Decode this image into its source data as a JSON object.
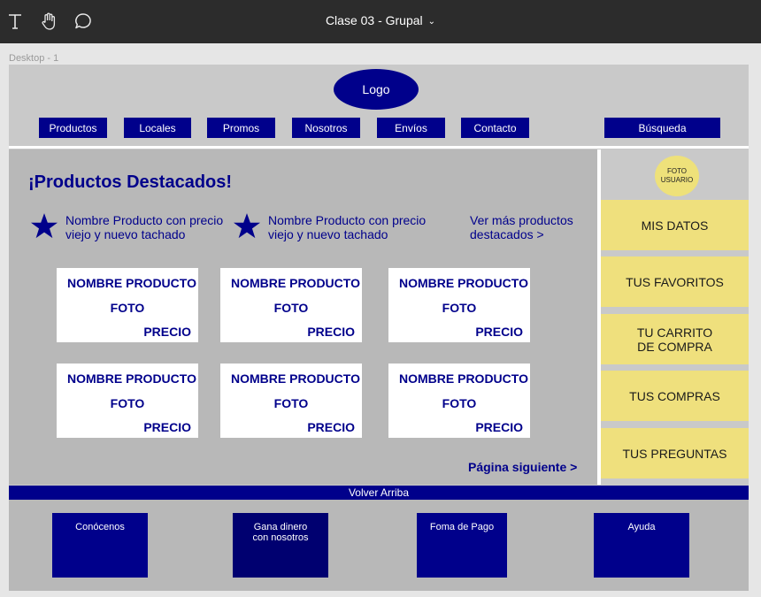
{
  "app": {
    "title": "Clase 03 - Grupal",
    "frame_label": "Desktop - 1"
  },
  "tools": [
    "text-tool-icon",
    "hand-tool-icon",
    "comment-tool-icon"
  ],
  "header": {
    "logo": "Logo",
    "nav": [
      "Productos",
      "Locales",
      "Promos",
      "Nosotros",
      "Envíos",
      "Contacto"
    ],
    "search": "Búsqueda"
  },
  "main": {
    "title": "¡Productos Destacados!",
    "featured": [
      {
        "line1": "Nombre Producto con precio",
        "line2": "viejo y nuevo tachado"
      },
      {
        "line1": "Nombre Producto con precio",
        "line2": "viejo y nuevo tachado"
      }
    ],
    "see_more": {
      "line1": "Ver más productos",
      "line2": "destacados >"
    },
    "cards": [
      {
        "name": "NOMBRE PRODUCTO",
        "photo": "FOTO",
        "price": "PRECIO"
      },
      {
        "name": "NOMBRE PRODUCTO",
        "photo": "FOTO",
        "price": "PRECIO"
      },
      {
        "name": "NOMBRE PRODUCTO",
        "photo": "FOTO",
        "price": "PRECIO"
      },
      {
        "name": "NOMBRE PRODUCTO",
        "photo": "FOTO",
        "price": "PRECIO"
      },
      {
        "name": "NOMBRE PRODUCTO",
        "photo": "FOTO",
        "price": "PRECIO"
      },
      {
        "name": "NOMBRE PRODUCTO",
        "photo": "FOTO",
        "price": "PRECIO"
      }
    ],
    "next_page": "Página siguiente >"
  },
  "sidebar": {
    "avatar": {
      "line1": "FOTO",
      "line2": "USUARIO"
    },
    "items": [
      {
        "line1": "MIS DATOS",
        "line2": ""
      },
      {
        "line1": "TUS FAVORITOS",
        "line2": ""
      },
      {
        "line1": "TU CARRITO",
        "line2": "DE COMPRA"
      },
      {
        "line1": "TUS COMPRAS",
        "line2": ""
      },
      {
        "line1": "TUS PREGUNTAS",
        "line2": ""
      }
    ]
  },
  "back_to_top": "Volver Arriba",
  "footer": [
    {
      "line1": "Conócenos",
      "line2": ""
    },
    {
      "line1": "Gana dinero",
      "line2": "con nosotros"
    },
    {
      "line1": "Foma de Pago",
      "line2": ""
    },
    {
      "line1": "Ayuda",
      "line2": ""
    }
  ],
  "colors": {
    "brand_navy": "#00008b",
    "accent_yellow": "#efe07d",
    "toolbar": "#2c2c2c"
  }
}
